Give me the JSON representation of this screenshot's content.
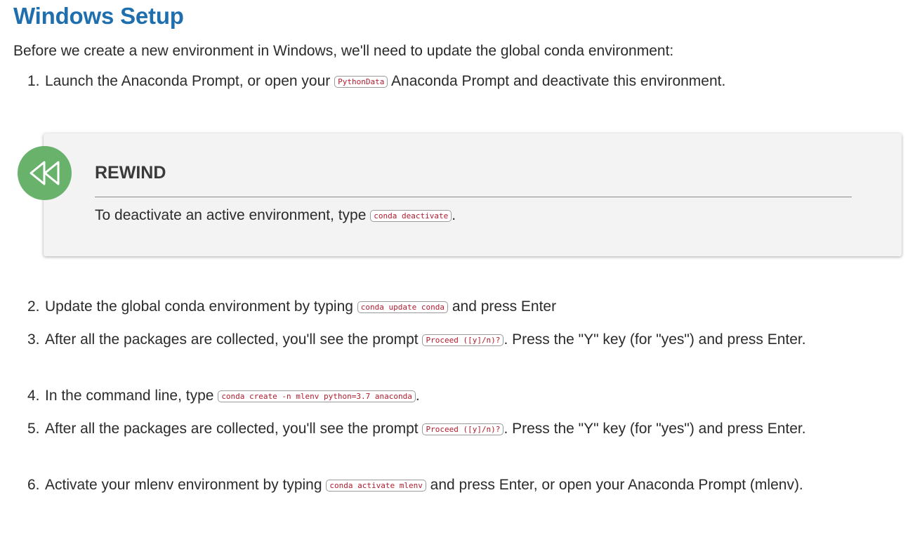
{
  "title": "Windows Setup",
  "intro": "Before we create a new environment in Windows, we'll need to update the global conda environment:",
  "steps": [
    {
      "number": "1.",
      "before": "Launch the Anaconda Prompt, or open your ",
      "code": "PythonData",
      "after": " Anaconda Prompt and deactivate this environment."
    },
    {
      "number": "2.",
      "before": "Update the global conda environment by typing ",
      "code": "conda update conda",
      "after": " and press Enter"
    },
    {
      "number": "3.",
      "before": "After all the packages are collected, you'll see the prompt ",
      "code": "Proceed ([y]/n)?",
      "after": ". Press the \"Y\" key (for \"yes\") and press Enter."
    },
    {
      "number": "4.",
      "before": "In the command line, type ",
      "code": "conda create -n mlenv python=3.7 anaconda",
      "after": "."
    },
    {
      "number": "5.",
      "before": "After all the packages are collected, you'll see the prompt ",
      "code": "Proceed ([y]/n)?",
      "after": ". Press the \"Y\" key (for \"yes\") and press Enter."
    },
    {
      "number": "6.",
      "before": "Activate your mlenv environment by typing ",
      "code": "conda activate mlenv",
      "after": " and press Enter, or open your Anaconda Prompt (mlenv)."
    }
  ],
  "rewind": {
    "icon": "rewind-icon",
    "title": "REWIND",
    "before": "To deactivate an active environment, type ",
    "code": "conda deactivate",
    "after": "."
  },
  "colors": {
    "heading": "#1f6fae",
    "code_text": "#b01c2e",
    "rewind_icon_bg": "#68b26c",
    "callout_bg": "#f3f3f3"
  }
}
